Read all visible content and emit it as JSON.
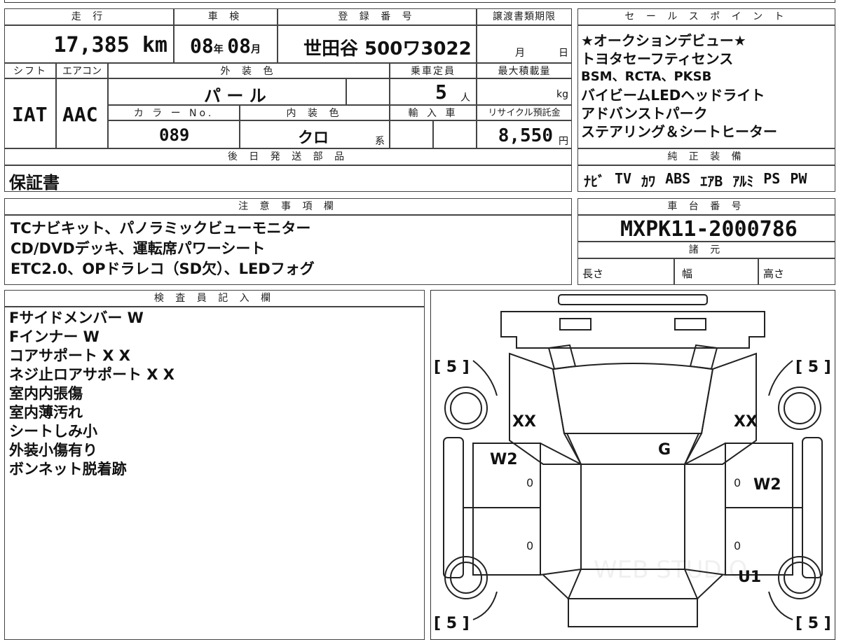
{
  "left_table": {
    "h_mileage": "走 行",
    "h_inspection": "車 検",
    "h_reg": "登 録 番 号",
    "h_transfer": "譲渡書類期限",
    "mileage": "17,385",
    "mileage_unit": "km",
    "insp_year": "08",
    "insp_year_unit": "年",
    "insp_month": "08",
    "insp_month_unit": "月",
    "reg_number": "世田谷 500ワ3022",
    "transfer_month": "月",
    "transfer_day": "日",
    "h_shift": "シフト",
    "h_ac": "エアコン",
    "h_color": "外 装 色",
    "h_capacity": "乗車定員",
    "h_maxload": "最大積載量",
    "shift": "IAT",
    "ac": "AAC",
    "color": "パ ー ル",
    "capacity": "5",
    "capacity_unit": "人",
    "maxload_unit": "kg",
    "h_color_no": "カ ラ ー No.",
    "h_interior": "内 装 色",
    "h_import": "輸 入 車",
    "h_recycle": "リサイクル預託金",
    "color_no": "089",
    "interior": "クロ",
    "interior_unit": "系",
    "recycle": "8,550",
    "recycle_unit": "円",
    "h_later": "後 日 発 送 部 品",
    "later": "保証書"
  },
  "sales_points": {
    "header": "セ ー ル ス ポ イ ン ト",
    "lines": [
      "★オークションデビュー★",
      "トヨタセーフティセンス",
      "BSM、RCTA、PKSB",
      "バイビームLEDヘッドライト",
      "アドバンストパーク",
      "ステアリング＆シートヒーター"
    ]
  },
  "equipment": {
    "header": "純 正 装 備",
    "items": [
      "ﾅﾋﾞ",
      "TV",
      "ｶﾜ",
      "ABS",
      "ｴｱB",
      "ｱﾙﾐ",
      "PS",
      "PW"
    ]
  },
  "notes": {
    "header": "注 意 事 項 欄",
    "lines": [
      "TCナビキット、パノラミックビューモニター",
      "CD/DVDデッキ、運転席パワーシート",
      "ETC2.0、OPドラレコ（SD欠）、LEDフォグ"
    ]
  },
  "chassis": {
    "header": "車 台 番 号",
    "number": "MXPK11-2000786",
    "spec_header": "諸 元",
    "length": "長さ",
    "width": "幅",
    "height": "高さ"
  },
  "inspector": {
    "header": "検 査 員 記 入 欄",
    "lines": [
      "Fサイドメンバー W",
      "Fインナー W",
      "コアサポート X X",
      "ネジ止ロアサポート X X",
      "室内内張傷",
      "室内薄汚れ",
      "シートしみ小",
      "外装小傷有り",
      "ボンネット脱着跡"
    ]
  },
  "diagram": {
    "tire_tl": "[ 5 ]",
    "tire_tr": "[ 5 ]",
    "tire_bl": "[ 5 ]",
    "tire_br": "[ 5 ]",
    "mark_xx_left": "XX",
    "mark_xx_right": "XX",
    "mark_g": "G",
    "mark_w2_left": "W2",
    "mark_w2_right": "W2",
    "mark_u1": "U1",
    "zero1": "0",
    "zero2": "0",
    "zero3": "0",
    "zero4": "0",
    "watermark": "WEB STUDIO"
  }
}
